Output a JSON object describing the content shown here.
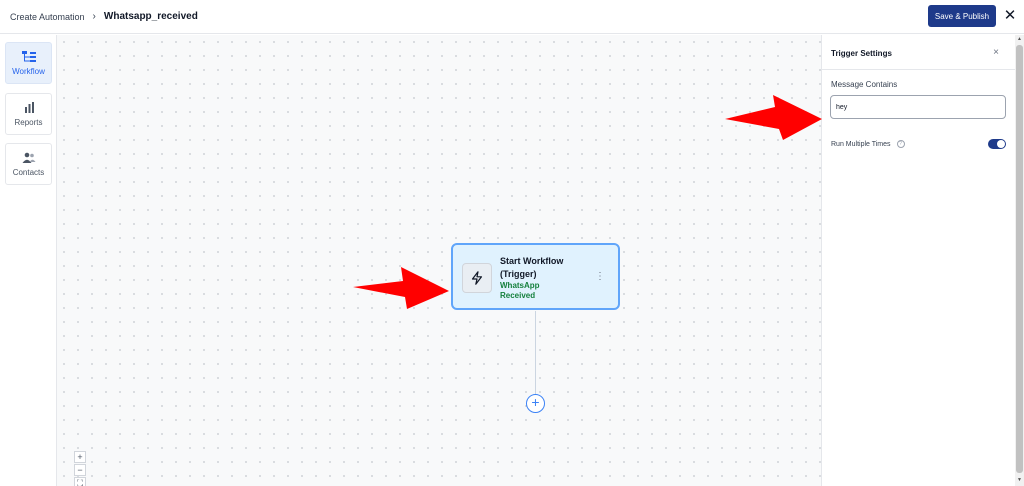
{
  "header": {
    "breadcrumb_parent": "Create Automation",
    "breadcrumb_separator": "›",
    "breadcrumb_current": "Whatsapp_received",
    "save_label": "Save & Publish",
    "close_glyph": "✕"
  },
  "sidebar": {
    "items": [
      {
        "label": "Workflow",
        "icon": "workflow-icon",
        "active": true
      },
      {
        "label": "Reports",
        "icon": "bar-chart-icon",
        "active": false
      },
      {
        "label": "Contacts",
        "icon": "users-icon",
        "active": false
      }
    ]
  },
  "canvas": {
    "node": {
      "title": "Start Workflow (Trigger)",
      "subtitle": "WhatsApp Received",
      "icon": "lightning-icon",
      "menu_glyph": "⋮"
    },
    "add_glyph": "+",
    "zoom_in": "+",
    "zoom_out": "−",
    "fit": "⛶"
  },
  "panel": {
    "title": "Trigger Settings",
    "close_glyph": "×",
    "message_label": "Message Contains",
    "message_value": "hey",
    "run_label": "Run Multiple Times",
    "help_glyph": "?",
    "run_enabled": true
  },
  "colors": {
    "primary": "#1e3a8a",
    "node_border": "#60a5fa",
    "node_bg": "#e0f2fe",
    "trigger_text": "#15803d",
    "annotation_arrow": "#ff0000"
  }
}
